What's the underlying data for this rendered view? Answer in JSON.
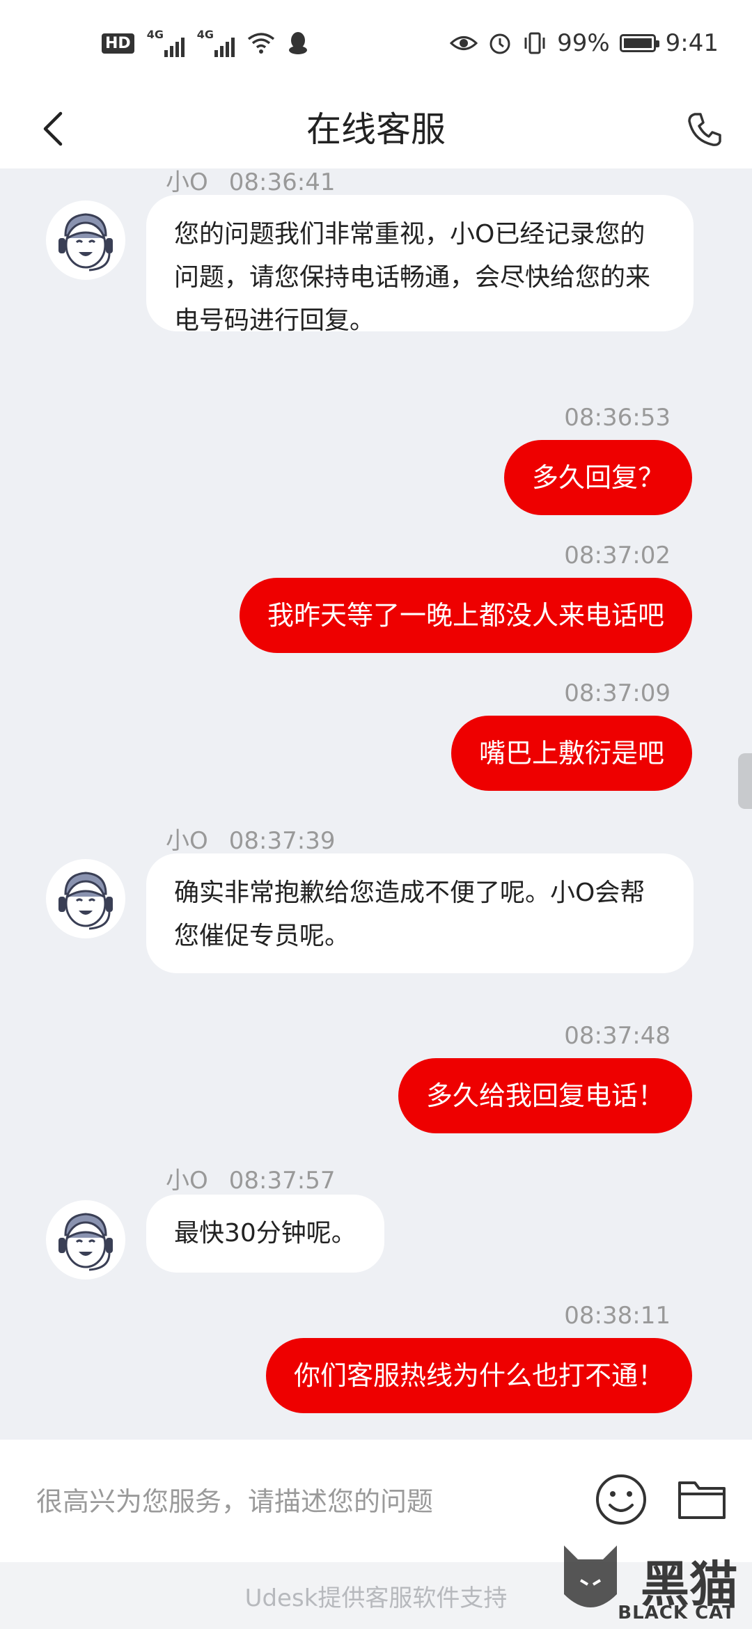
{
  "status_bar": {
    "hd": "HD",
    "signal_label_1": "4G",
    "signal_label_2": "4G",
    "battery_percent": "99%",
    "time": "9:41",
    "icons": [
      "eye-icon",
      "alarm-icon",
      "vibrate-icon",
      "battery-icon",
      "wifi-icon",
      "qq-icon"
    ]
  },
  "header": {
    "title": "在线客服",
    "back_icon": "chevron-left-icon",
    "phone_icon": "phone-icon"
  },
  "messages": [
    {
      "side": "in",
      "sender": "小O",
      "time": "08:36:41",
      "text": "您的问题我们非常重视，小O已经记录您的问题，请您保持电话畅通，会尽快给您的来电号码进行回复。"
    },
    {
      "side": "out",
      "time": "08:36:53",
      "text": "多久回复？"
    },
    {
      "side": "out",
      "time": "08:37:02",
      "text": "我昨天等了一晚上都没人来电话吧"
    },
    {
      "side": "out",
      "time": "08:37:09",
      "text": "嘴巴上敷衍是吧"
    },
    {
      "side": "in",
      "sender": "小O",
      "time": "08:37:39",
      "text": "确实非常抱歉给您造成不便了呢。小O会帮您催促专员呢。"
    },
    {
      "side": "out",
      "time": "08:37:48",
      "text": "多久给我回复电话！"
    },
    {
      "side": "in",
      "sender": "小O",
      "time": "08:37:57",
      "text": "最快30分钟呢。"
    },
    {
      "side": "out",
      "time": "08:38:11",
      "text": "你们客服热线为什么也打不通！"
    }
  ],
  "input": {
    "placeholder": "很高兴为您服务，请描述您的问题",
    "emoji_icon": "emoji-icon",
    "folder_icon": "folder-icon"
  },
  "footer": {
    "text": "Udesk提供客服软件支持"
  },
  "watermark": {
    "chinese": "黑猫",
    "english": "BLACK CAT"
  },
  "colors": {
    "outgoing_bubble": "#ee0000",
    "incoming_bubble": "#ffffff",
    "chat_background": "#eef0f4"
  }
}
